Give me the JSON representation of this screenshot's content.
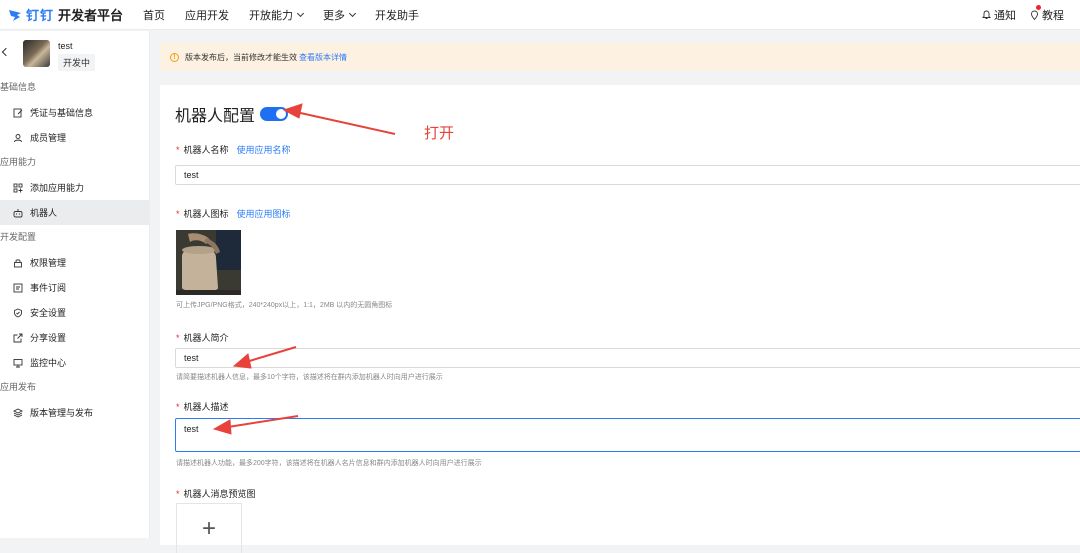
{
  "header": {
    "logo_brand": "钉钉",
    "logo_title": "开发者平台",
    "nav": [
      "首页",
      "应用开发",
      "开放能力",
      "更多",
      "开发助手"
    ],
    "notify": "通知",
    "tutorial": "教程"
  },
  "sidebar": {
    "app_name": "test",
    "app_status": "开发中",
    "groups": {
      "basic": "基础信息",
      "ability": "应用能力",
      "dev": "开发配置",
      "publish": "应用发布"
    },
    "items": {
      "credentials": "凭证与基础信息",
      "members": "成员管理",
      "add_ability": "添加应用能力",
      "robot": "机器人",
      "permissions": "权限管理",
      "events": "事件订阅",
      "security": "安全设置",
      "share": "分享设置",
      "monitor": "监控中心",
      "versions": "版本管理与发布"
    }
  },
  "notice": {
    "text": "版本发布后，当前修改才能生效",
    "link": "查看版本详情"
  },
  "robot_config": {
    "title": "机器人配置",
    "enabled": true,
    "name_label": "机器人名称",
    "name_link": "使用应用名称",
    "name_value": "test",
    "icon_label": "机器人图标",
    "icon_link": "使用应用图标",
    "icon_hint": "可上传JPG/PNG格式，240*240px以上，1:1，2MB 以内的无圆角图标",
    "intro_label": "机器人简介",
    "intro_value": "test",
    "intro_hint": "请简要描述机器人信息，最多10个字符，该描述将在群内添加机器人时向用户进行展示",
    "desc_label": "机器人描述",
    "desc_value": "test",
    "desc_hint": "请描述机器人功能，最多200字符，该描述将在机器人名片信息和群内添加机器人时向用户进行展示",
    "preview_label": "机器人消息预览图",
    "upload_symbol": "+"
  },
  "annotations": {
    "open_label": "打开",
    "color": "#e8433b"
  }
}
